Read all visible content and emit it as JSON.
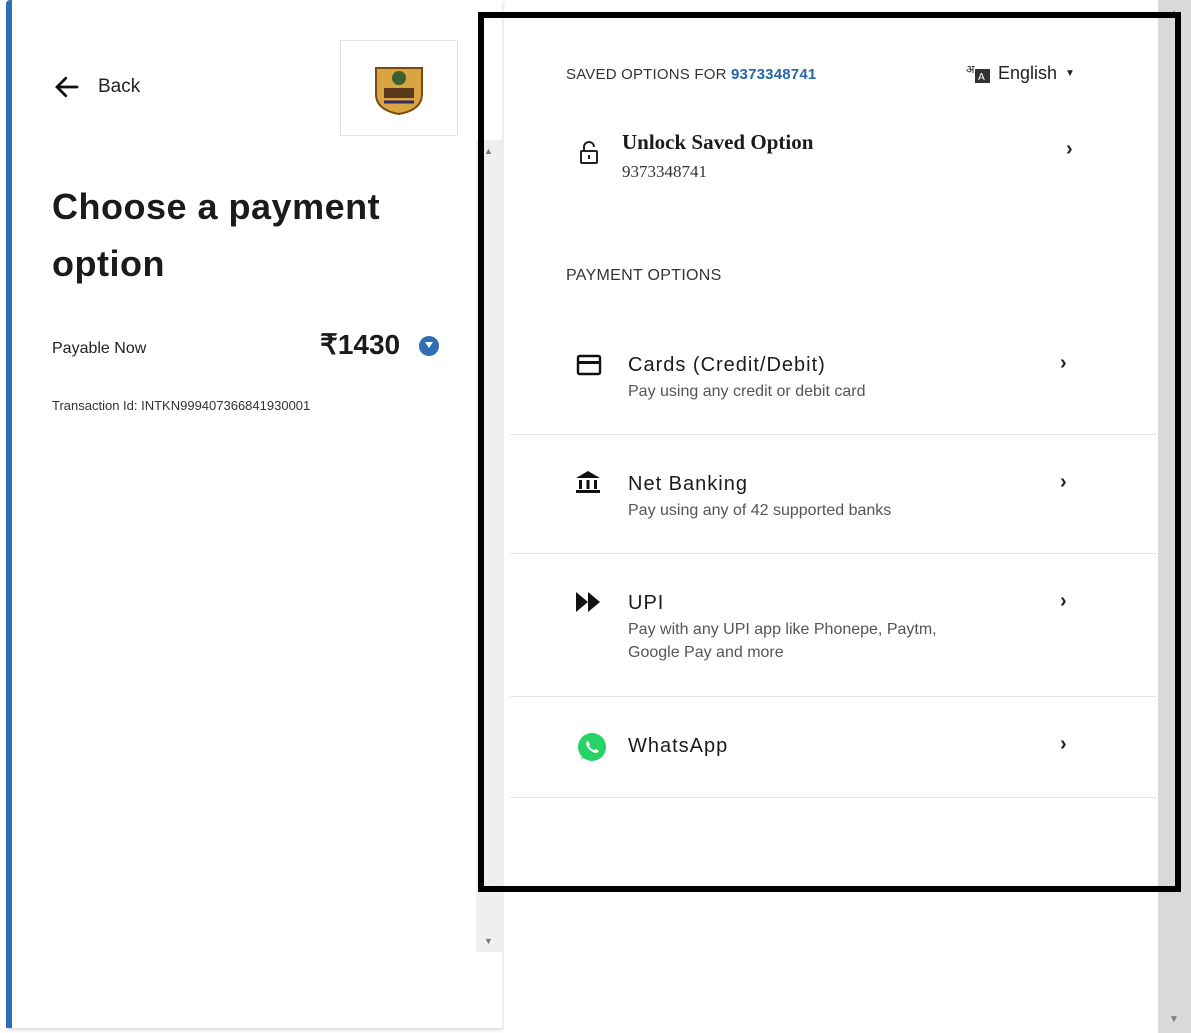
{
  "left": {
    "back_label": "Back",
    "title": "Choose a payment option",
    "payable_label": "Payable Now",
    "amount": "₹1430",
    "transaction_id": "Transaction Id: INTKN9994073668419300​01"
  },
  "right": {
    "saved_prefix": "SAVED OPTIONS FOR ",
    "saved_number": "9373348741",
    "language": "English",
    "unlock_title": "Unlock Saved Option",
    "unlock_number": "9373348741",
    "payment_options_header": "PAYMENT OPTIONS",
    "options": [
      {
        "name": "Cards (Credit/Debit)",
        "desc": "Pay using any credit or debit card"
      },
      {
        "name": "Net Banking",
        "desc": "Pay using any of 42 supported banks"
      },
      {
        "name": "UPI",
        "desc": "Pay with any UPI app like Phonepe, Paytm, Google Pay and more"
      },
      {
        "name": "WhatsApp",
        "desc": ""
      }
    ]
  },
  "colors": {
    "accent": "#2f6db5",
    "link": "#2466a8",
    "whatsapp": "#25d366"
  }
}
